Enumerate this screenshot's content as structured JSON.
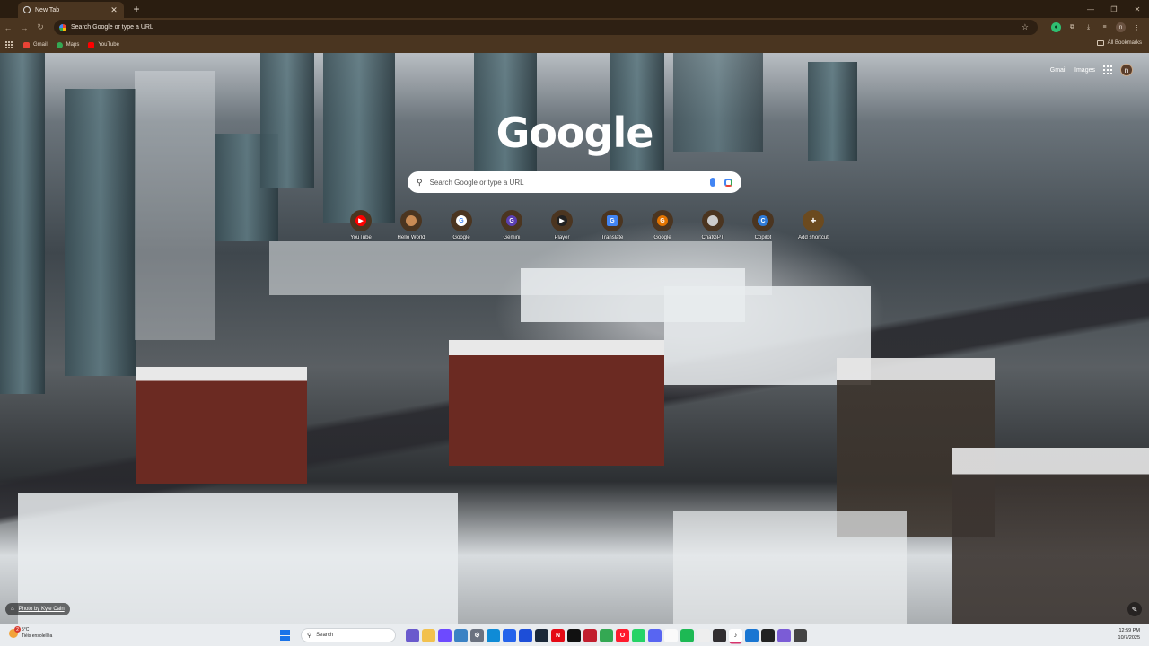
{
  "window": {
    "tab_title": "New Tab",
    "tab_close_icon": "✕",
    "new_tab_icon": "+",
    "controls": [
      "—",
      "❐",
      "✕"
    ]
  },
  "toolbar": {
    "back_icon": "←",
    "forward_icon": "→",
    "reload_icon": "↻",
    "omnibox_text": "Search Google or type a URL",
    "star_icon": "☆",
    "extensions": [
      "icon-green-ext",
      "puzzle-icon",
      "download-icon",
      "profile-icon"
    ],
    "profile_letter": "n",
    "menu_icon": "⋮"
  },
  "bookmarks": {
    "items": [
      {
        "label": "Gmail",
        "color": "#ea4335"
      },
      {
        "label": "Maps",
        "color": "#34a853"
      },
      {
        "label": "YouTube",
        "color": "#ff0000"
      }
    ],
    "all_bookmarks": "All Bookmarks"
  },
  "ntp": {
    "gmail": "Gmail",
    "images": "Images",
    "avatar_letter": "n",
    "logo": "Google",
    "search_placeholder": "Search Google or type a URL",
    "shortcuts": [
      {
        "label": "YouTube",
        "glyph": "▶",
        "color": "#ff0000"
      },
      {
        "label": "Hello World",
        "glyph": "",
        "color": "#c98b55"
      },
      {
        "label": "Google",
        "glyph": "G",
        "color": "#4285f4"
      },
      {
        "label": "Gemini",
        "glyph": "G",
        "color": "#5b3fb3"
      },
      {
        "label": "Player",
        "glyph": "▶",
        "color": "#222222"
      },
      {
        "label": "Translate",
        "glyph": "G",
        "color": "#4285f4"
      },
      {
        "label": "Google",
        "glyph": "G",
        "color": "#e37400"
      },
      {
        "label": "ChatGPT",
        "glyph": "",
        "color": "#cccccc"
      },
      {
        "label": "Copilot",
        "glyph": "C",
        "color": "#2f7bd8"
      },
      {
        "label": "Add shortcut",
        "glyph": "+",
        "color": "#4b3520"
      }
    ],
    "photo_credit": "Photo by Kyle Cain",
    "customize_icon": "✎"
  },
  "taskbar": {
    "weather_temp": "5°C",
    "weather_desc": "Tiéis ensolelléa",
    "weather_badge": "2",
    "search_label": "Search",
    "apps": [
      {
        "name": "copilot-app",
        "color": "#6a5acd",
        "glyph": ""
      },
      {
        "name": "file-explorer-app",
        "color": "#f2c14e",
        "glyph": ""
      },
      {
        "name": "proton-vpn-app",
        "color": "#6d4aff",
        "glyph": ""
      },
      {
        "name": "photos-app",
        "color": "#3b82c4",
        "glyph": ""
      },
      {
        "name": "settings-app",
        "color": "#6b7280",
        "glyph": "⚙"
      },
      {
        "name": "edge-app",
        "color": "#0f8bd6",
        "glyph": ""
      },
      {
        "name": "store-app",
        "color": "#2563eb",
        "glyph": ""
      },
      {
        "name": "mail-app",
        "color": "#1d4ed8",
        "glyph": ""
      },
      {
        "name": "steam-app",
        "color": "#1b2838",
        "glyph": ""
      },
      {
        "name": "netflix-app",
        "color": "#e50914",
        "glyph": "N"
      },
      {
        "name": "spotify-like-app",
        "color": "#111111",
        "glyph": ""
      },
      {
        "name": "davinci-app",
        "color": "#c21f2f",
        "glyph": ""
      },
      {
        "name": "chrome-app",
        "color": "#34a853",
        "glyph": ""
      },
      {
        "name": "opera-app",
        "color": "#ff1b2d",
        "glyph": "O"
      },
      {
        "name": "whatsapp-app",
        "color": "#25d366",
        "glyph": ""
      },
      {
        "name": "discord-app",
        "color": "#5865f2",
        "glyph": ""
      },
      {
        "name": "notepad-app",
        "color": "#fafafa",
        "glyph": ""
      },
      {
        "name": "spotify-app",
        "color": "#1db954",
        "glyph": ""
      },
      {
        "name": "unknown-app",
        "color": "#eeeeee",
        "glyph": ""
      },
      {
        "name": "obs-app",
        "color": "#302e31",
        "glyph": ""
      },
      {
        "name": "tiktok-app",
        "color": "#111111",
        "glyph": "♪"
      },
      {
        "name": "helper-app",
        "color": "#1976d2",
        "glyph": ""
      },
      {
        "name": "terminal-app",
        "color": "#222222",
        "glyph": ""
      },
      {
        "name": "teams-app",
        "color": "#7b5cd6",
        "glyph": ""
      },
      {
        "name": "calculator-app",
        "color": "#444444",
        "glyph": ""
      }
    ],
    "time": "12:59 PM",
    "date": "10/7/2025"
  }
}
